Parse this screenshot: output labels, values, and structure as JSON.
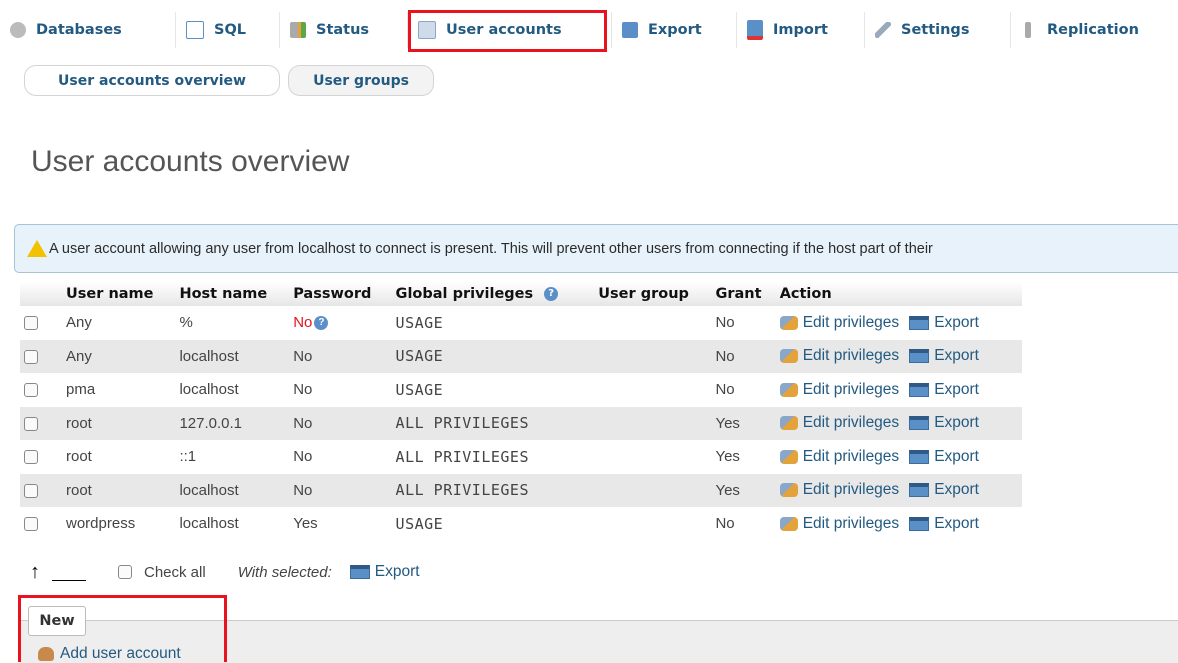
{
  "top_tabs": [
    {
      "label": "Databases",
      "icon": "database-icon"
    },
    {
      "label": "SQL",
      "icon": "sql-icon"
    },
    {
      "label": "Status",
      "icon": "status-icon"
    },
    {
      "label": "User accounts",
      "icon": "user-accounts-icon",
      "active": true
    },
    {
      "label": "Export",
      "icon": "export-icon"
    },
    {
      "label": "Import",
      "icon": "import-icon"
    },
    {
      "label": "Settings",
      "icon": "wrench-icon"
    },
    {
      "label": "Replication",
      "icon": "replication-icon"
    }
  ],
  "sub_tabs": [
    {
      "label": "User accounts overview",
      "active": true
    },
    {
      "label": "User groups"
    }
  ],
  "page_title": "User accounts overview",
  "notice": "A user account allowing any user from localhost to connect is present. This will prevent other users from connecting if the host part of their",
  "table": {
    "headers": [
      "User name",
      "Host name",
      "Password",
      "Global privileges",
      "User group",
      "Grant",
      "Action"
    ],
    "rows": [
      {
        "user": "Any",
        "host": "%",
        "password": "No",
        "privileges": "USAGE",
        "group": "",
        "grant": "No",
        "user_red": true,
        "password_red": true,
        "password_help": true
      },
      {
        "user": "Any",
        "host": "localhost",
        "password": "No",
        "privileges": "USAGE",
        "group": "",
        "grant": "No",
        "user_red": true,
        "password_red": true
      },
      {
        "user": "pma",
        "host": "localhost",
        "password": "No",
        "privileges": "USAGE",
        "group": "",
        "grant": "No",
        "password_red": true
      },
      {
        "user": "root",
        "host": "127.0.0.1",
        "password": "No",
        "privileges": "ALL PRIVILEGES",
        "group": "",
        "grant": "Yes",
        "password_red": true
      },
      {
        "user": "root",
        "host": "::1",
        "password": "No",
        "privileges": "ALL PRIVILEGES",
        "group": "",
        "grant": "Yes",
        "password_red": true
      },
      {
        "user": "root",
        "host": "localhost",
        "password": "No",
        "privileges": "ALL PRIVILEGES",
        "group": "",
        "grant": "Yes",
        "password_red": true
      },
      {
        "user": "wordpress",
        "host": "localhost",
        "password": "Yes",
        "privileges": "USAGE",
        "group": "",
        "grant": "No"
      }
    ],
    "action_edit": "Edit privileges",
    "action_export": "Export"
  },
  "bulk": {
    "check_all": "Check all",
    "with_selected": "With selected:",
    "export": "Export"
  },
  "new_section": {
    "legend": "New",
    "add_user": "Add user account"
  },
  "colors": {
    "link": "#235a81",
    "highlight": "#e8131e",
    "row_alt": "#e8e8e8"
  }
}
